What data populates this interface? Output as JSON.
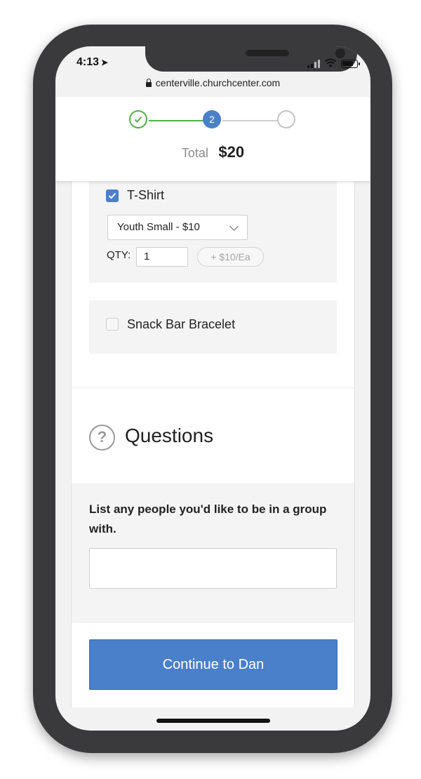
{
  "status_bar": {
    "time": "4:13"
  },
  "browser": {
    "url": "centerville.churchcenter.com"
  },
  "steps": {
    "current_step": "2"
  },
  "total": {
    "label": "Total",
    "value": "$20"
  },
  "addons": {
    "tshirt": {
      "checked": true,
      "label": "T-Shirt",
      "size_selected": "Youth Small - $10",
      "qty_label": "QTY:",
      "qty_value": "1",
      "price_per": "+ $10/Ea"
    },
    "snack": {
      "checked": false,
      "label": "Snack Bar Bracelet"
    }
  },
  "questions": {
    "title": "Questions",
    "items": [
      {
        "question": "List any people you'd like to be in a group with.",
        "answer": ""
      }
    ]
  },
  "footer": {
    "continue_label": "Continue to Dan"
  },
  "colors": {
    "accent": "#4a7fc9",
    "success": "#52b14a",
    "frame": "#3a3a3c"
  }
}
